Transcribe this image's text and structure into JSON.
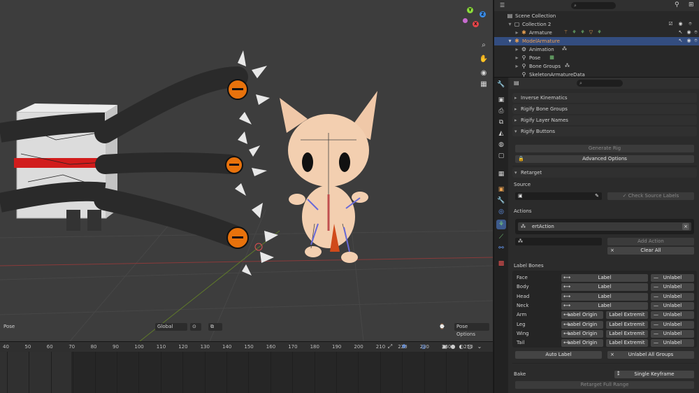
{
  "viewport": {
    "mode_label": "Pose",
    "shading_label": "Global",
    "pose_options_label": "Pose Options",
    "nav_icons": [
      "zoom-icon",
      "hand-icon",
      "camera-icon",
      "grid-icon"
    ],
    "gizmo": {
      "x": "X",
      "y": "Y",
      "z": "Z"
    }
  },
  "timeline": {
    "ticks": [
      "40",
      "50",
      "60",
      "70",
      "80",
      "90",
      "100",
      "110",
      "120",
      "130",
      "140",
      "150",
      "160",
      "170",
      "180",
      "190",
      "200",
      "210",
      "220",
      "230",
      "240",
      "250"
    ]
  },
  "outliner": {
    "search_placeholder": "",
    "rows": [
      {
        "label": "Scene Collection"
      },
      {
        "label": "Collection 2"
      },
      {
        "label": "Armature"
      },
      {
        "label": "ModelArmature"
      },
      {
        "label": "Animation"
      },
      {
        "label": "Pose"
      },
      {
        "label": "Bone Groups"
      },
      {
        "label": "SkeletonArmatureData"
      }
    ]
  },
  "properties": {
    "panels": {
      "ik": "Inverse Kinematics",
      "rigify_bone_groups": "Rigify Bone Groups",
      "rigify_layer_names": "Rigify Layer Names",
      "rigify_buttons": "Rigify Buttons",
      "retarget": "Retarget"
    },
    "rigify": {
      "generate_label": "Generate Rig",
      "advanced_label": "Advanced Options"
    },
    "retarget": {
      "source_label": "Source",
      "check_labels": "Check Source Labels",
      "actions_label": "Actions",
      "action_name": "ertAction",
      "add_action": "Add Action",
      "clear_all": "Clear All",
      "label_bones_heading": "Label Bones",
      "rows": [
        {
          "name": "Face",
          "a": "Label",
          "b": null,
          "c": "Unlabel"
        },
        {
          "name": "Body",
          "a": "Label",
          "b": null,
          "c": "Unlabel"
        },
        {
          "name": "Head",
          "a": "Label",
          "b": null,
          "c": "Unlabel"
        },
        {
          "name": "Neck",
          "a": "Label",
          "b": null,
          "c": "Unlabel"
        },
        {
          "name": "Arm",
          "a": "Label Origin",
          "b": "Label Extremit",
          "c": "Unlabel"
        },
        {
          "name": "Leg",
          "a": "Label Origin",
          "b": "Label Extremit",
          "c": "Unlabel"
        },
        {
          "name": "Wing",
          "a": "Label Origin",
          "b": "Label Extremit",
          "c": "Unlabel"
        },
        {
          "name": "Tail",
          "a": "Label Origin",
          "b": "Label Extremit",
          "c": "Unlabel"
        }
      ],
      "auto_label": "Auto Label",
      "unlabel_all": "Unlabel All Groups",
      "bake_label": "Bake",
      "bake_value": "Single Keyframe",
      "bake_button": "Retarget Full Range"
    }
  },
  "colors": {
    "viewport_bg": "#3d3d3d",
    "selection": "#334d80",
    "accent_orange": "#e8720c"
  }
}
